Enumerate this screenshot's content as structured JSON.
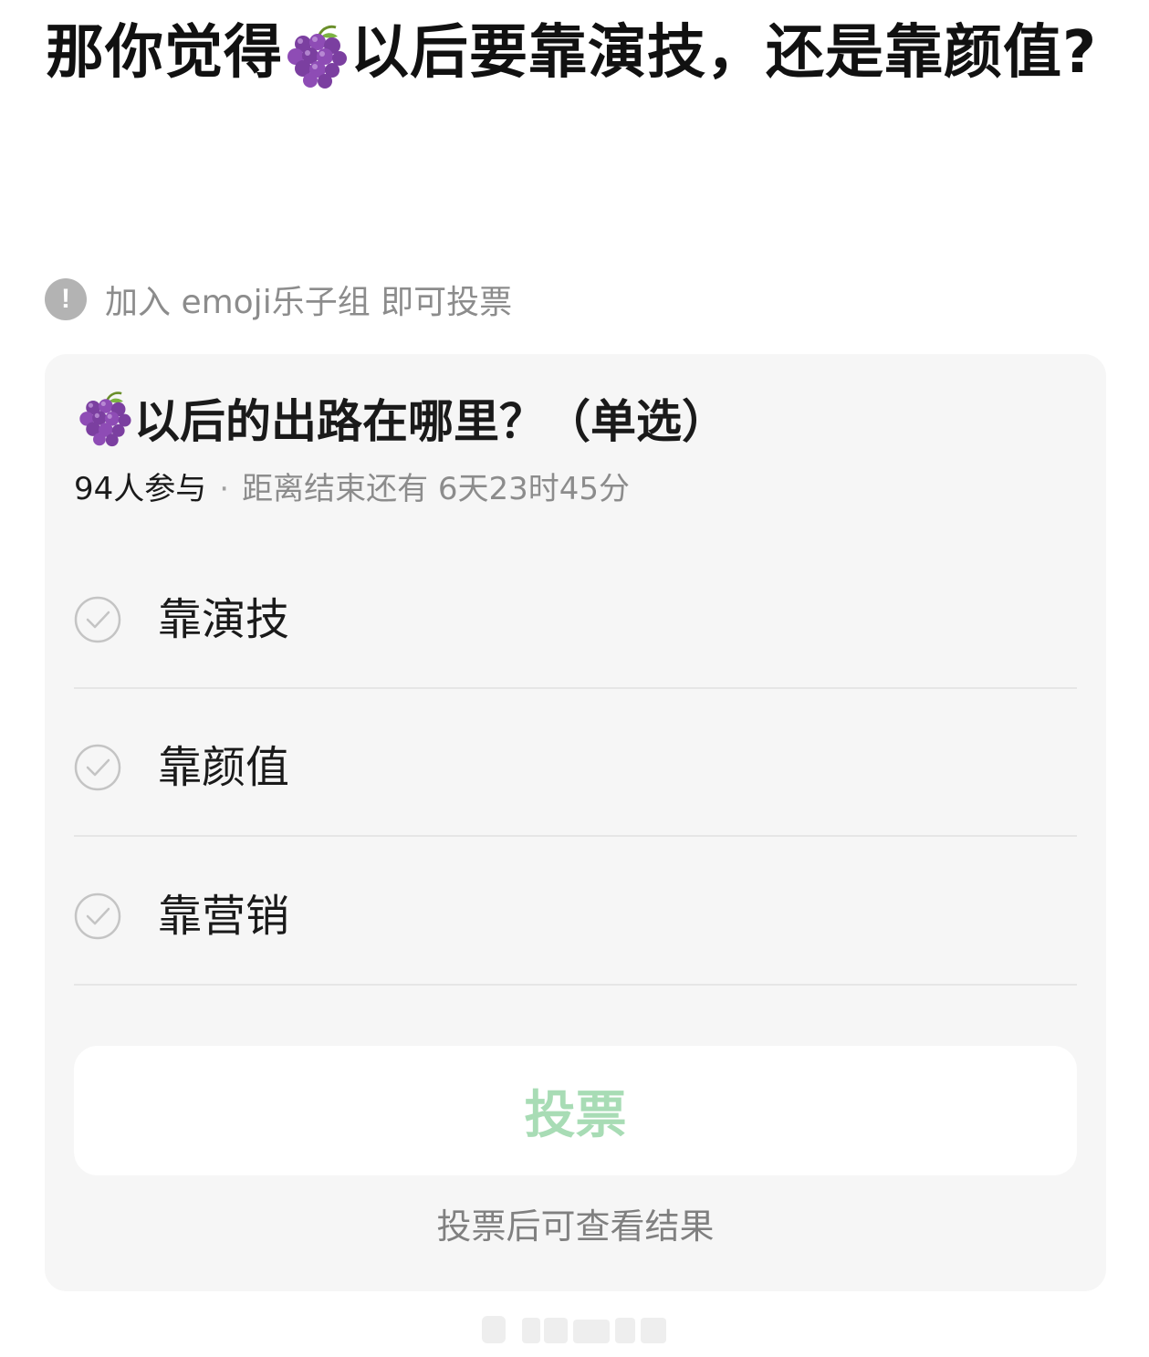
{
  "post": {
    "title_before": "那你觉得",
    "title_emoji": "grapes-emoji",
    "title_after": "以后要靠演技，还是靠颜值?"
  },
  "join_notice": {
    "icon": "exclamation-circle-icon",
    "text": "加入 emoji乐子组 即可投票"
  },
  "poll": {
    "question_emoji": "grapes-emoji",
    "question": "以后的出路在哪里？（单选）",
    "participants": "94人参与",
    "separator": "·",
    "countdown": "距离结束还有 6天23时45分",
    "options": [
      {
        "label": "靠演技",
        "icon": "check-circle-icon"
      },
      {
        "label": "靠颜值",
        "icon": "check-circle-icon"
      },
      {
        "label": "靠营销",
        "icon": "check-circle-icon"
      }
    ],
    "vote_button": "投票",
    "hint": "投票后可查看结果"
  },
  "colors": {
    "card_background": "#f6f6f6",
    "vote_button_text": "#a8dcb5",
    "muted_text": "#8c8c8c",
    "notice_icon": "#b3b3b3"
  }
}
